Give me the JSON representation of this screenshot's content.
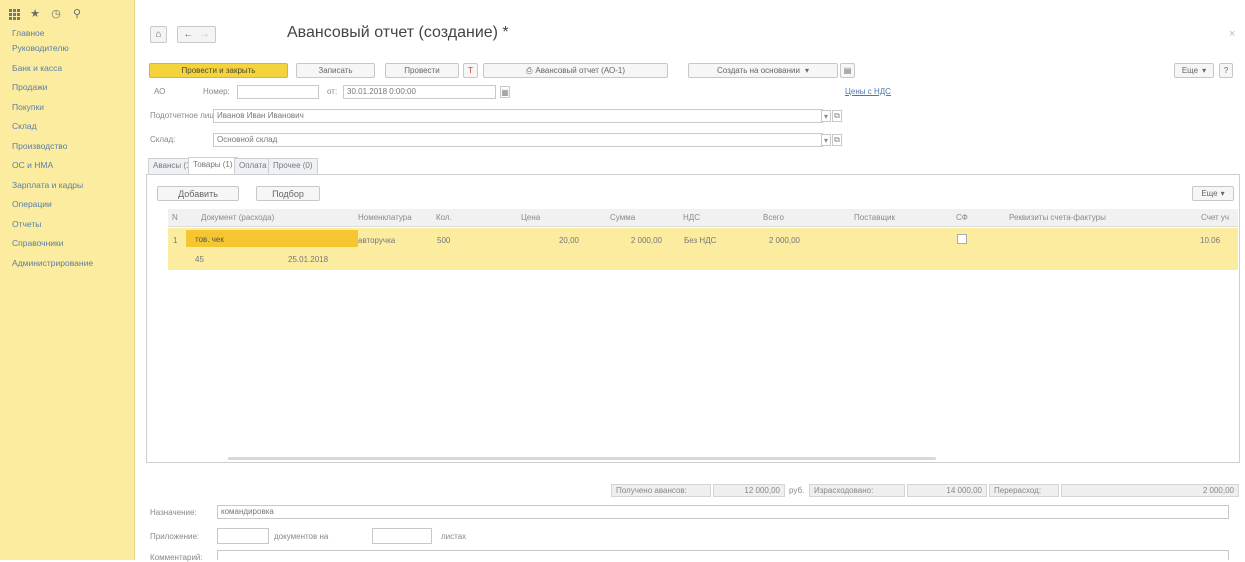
{
  "sidebar": {
    "items": [
      {
        "label": "Главное"
      },
      {
        "label": "Руководителю"
      },
      {
        "label": "Банк и касса"
      },
      {
        "label": "Продажи"
      },
      {
        "label": "Покупки"
      },
      {
        "label": "Склад"
      },
      {
        "label": "Производство"
      },
      {
        "label": "ОС и НМА"
      },
      {
        "label": "Зарплата и кадры"
      },
      {
        "label": "Операции"
      },
      {
        "label": "Отчеты"
      },
      {
        "label": "Справочники"
      },
      {
        "label": "Администрирование"
      }
    ]
  },
  "header": {
    "title": "Авансовый отчет (создание) *",
    "home_icon": "⌂",
    "back_icon": "←",
    "forward_icon": "→",
    "close_icon": "×"
  },
  "toolbar": {
    "post_and_close": "Провести и закрыть",
    "save": "Записать",
    "post": "Провести",
    "report_ao1": "Авансовый отчет (АО-1)",
    "create_based_on": "Создать на основании",
    "more": "Еще",
    "help": "?"
  },
  "form": {
    "number_prefix": "АО",
    "number_label": "Номер:",
    "number_value": "",
    "date_label": "от:",
    "date_value": "30.01.2018 0:00:00",
    "prices_link": "Цены с НДС",
    "person_label": "Подотчетное лицо:",
    "person_value": "Иванов Иван Иванович",
    "warehouse_label": "Склад:",
    "warehouse_value": "Основной склад"
  },
  "tabs": [
    {
      "label": "Авансы (1)"
    },
    {
      "label": "Товары (1)"
    },
    {
      "label": "Оплата"
    },
    {
      "label": "Прочее (0)"
    }
  ],
  "table": {
    "add_button": "Добавить",
    "pick_button": "Подбор",
    "more_button": "Еще",
    "columns": [
      {
        "label": "N"
      },
      {
        "label": "Документ (расхода)"
      },
      {
        "label": "Номенклатура"
      },
      {
        "label": "Кол."
      },
      {
        "label": "Цена"
      },
      {
        "label": "Сумма"
      },
      {
        "label": "НДС"
      },
      {
        "label": "Всего"
      },
      {
        "label": "Поставщик"
      },
      {
        "label": "СФ"
      },
      {
        "label": "Реквизиты счета-фактуры"
      },
      {
        "label": "Счет уч"
      }
    ],
    "rows": [
      {
        "n": "1",
        "doc_type": "тов. чек",
        "doc_number": "45",
        "doc_date": "25.01.2018",
        "item": "авторучка",
        "qty": "500",
        "price": "20,00",
        "sum": "2 000,00",
        "vat": "Без НДС",
        "total": "2 000,00",
        "supplier": "",
        "account": "10.06"
      }
    ]
  },
  "totals": {
    "received_label": "Получено авансов:",
    "received_value": "12 000,00",
    "currency": "руб.",
    "spent_label": "Израсходовано:",
    "spent_value": "14 000,00",
    "overspent_label": "Перерасход:",
    "overspent_value": "2 000,00"
  },
  "footer": {
    "purpose_label": "Назначение:",
    "purpose_value": "командировка",
    "attachment_label": "Приложение:",
    "docs_on_label": "документов на",
    "sheets_label": "листах",
    "comment_label": "Комментарий:"
  }
}
